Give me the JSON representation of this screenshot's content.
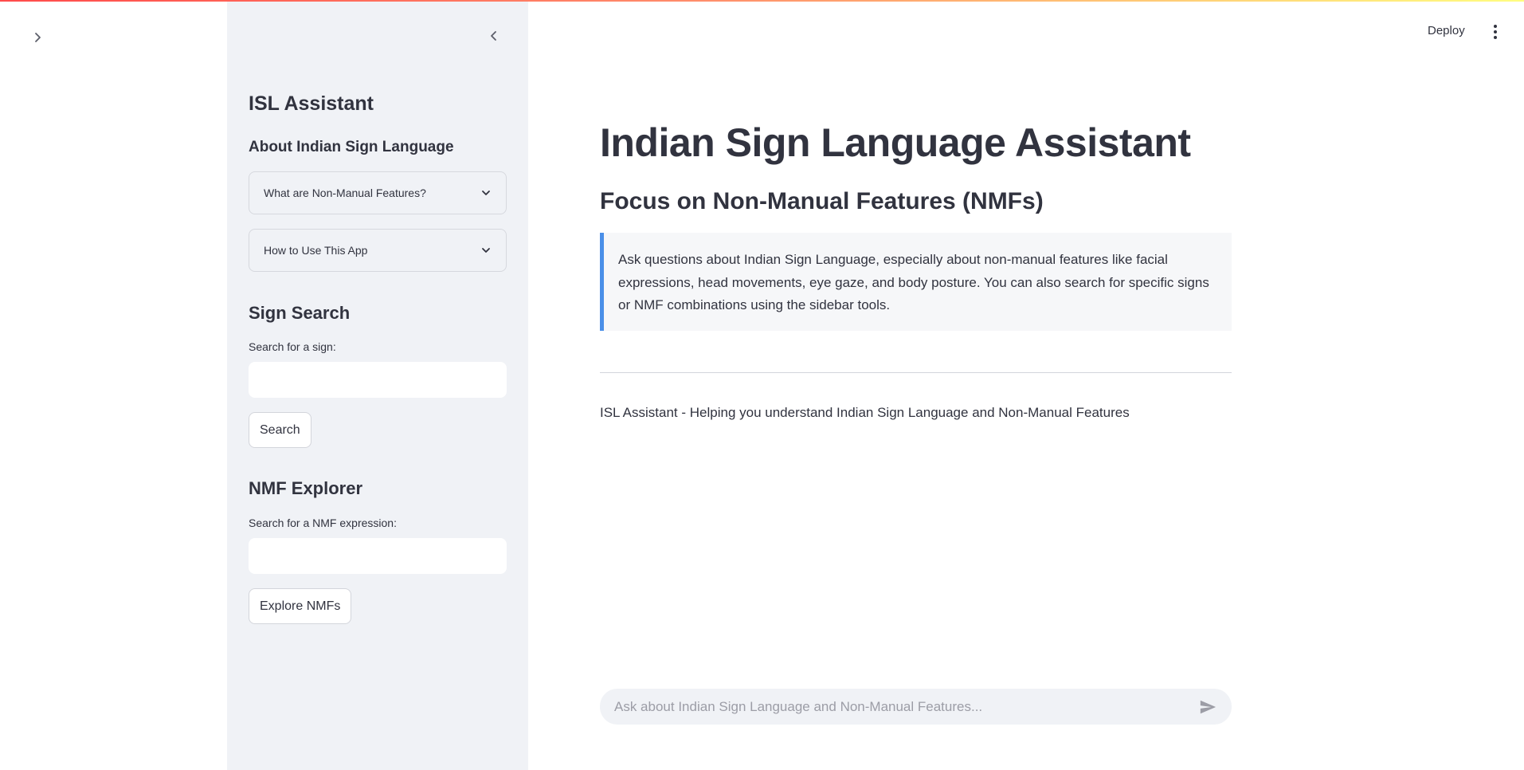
{
  "sidebar": {
    "title": "ISL Assistant",
    "about_heading": "About Indian Sign Language",
    "expanders": [
      {
        "label": "What are Non-Manual Features?"
      },
      {
        "label": "How to Use This App"
      }
    ],
    "sign_search": {
      "heading": "Sign Search",
      "label": "Search for a sign:",
      "value": "",
      "button": "Search"
    },
    "nmf_explorer": {
      "heading": "NMF Explorer",
      "label": "Search for a NMF expression:",
      "value": "",
      "button": "Explore NMFs"
    }
  },
  "header": {
    "deploy_label": "Deploy"
  },
  "main": {
    "title": "Indian Sign Language Assistant",
    "subtitle": "Focus on Non-Manual Features (NMFs)",
    "info": "Ask questions about Indian Sign Language, especially about non-manual features like facial expressions, head movements, eye gaze, and body posture. You can also search for specific signs or NMF combinations using the sidebar tools.",
    "footer": "ISL Assistant - Helping you understand Indian Sign Language and Non-Manual Features"
  },
  "chat": {
    "placeholder": "Ask about Indian Sign Language and Non-Manual Features...",
    "value": ""
  },
  "colors": {
    "sidebar_bg": "#f0f2f6",
    "info_accent": "#4a8fe8",
    "text": "#31333f"
  },
  "icons": {
    "expand": "chevron-right-icon",
    "collapse": "chevron-left-icon",
    "expander": "chevron-down-icon",
    "menu": "kebab-menu-icon",
    "send": "send-icon"
  }
}
